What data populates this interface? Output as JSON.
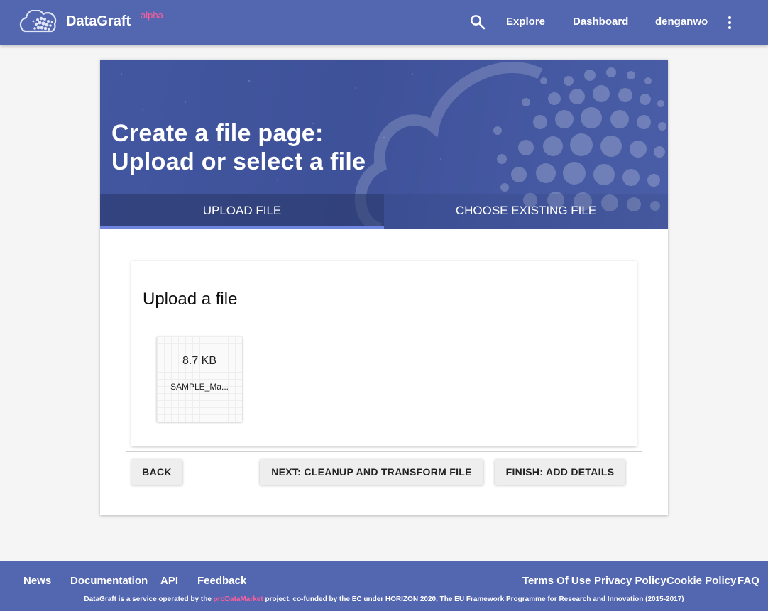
{
  "header": {
    "brand": "DataGraft",
    "brand_sup": "alpha",
    "nav": {
      "explore": "Explore",
      "dashboard": "Dashboard",
      "user": "denganwo"
    }
  },
  "hero": {
    "title_line1": "Create a file page:",
    "title_line2": "Upload or select a file",
    "tabs": [
      {
        "label": "UPLOAD FILE",
        "active": true
      },
      {
        "label": "CHOOSE EXISTING FILE",
        "active": false
      }
    ]
  },
  "panel": {
    "title": "Upload a file",
    "file": {
      "size": "8.7 KB",
      "name": "SAMPLE_Ma..."
    }
  },
  "actions": {
    "back": "BACK",
    "next": "NEXT: CLEANUP AND TRANSFORM FILE",
    "finish": "FINISH: ADD DETAILS"
  },
  "footer": {
    "left_links": [
      "News",
      "Documentation",
      "API",
      "Feedback"
    ],
    "right_links": [
      "Terms Of Use",
      "Privacy Policy",
      "Cookie Policy",
      "FAQ"
    ],
    "credit_before": "DataGraft is a service operated by the ",
    "credit_link": "proDataMarket",
    "credit_after": " project, co-funded by the EC under HORIZON 2020, The EU Framework Programme for Research and Innovation (2015-2017)"
  },
  "colors": {
    "primary": "#5366b0",
    "accent": "#ff5e9a",
    "tab_indicator": "#6f86e0"
  }
}
